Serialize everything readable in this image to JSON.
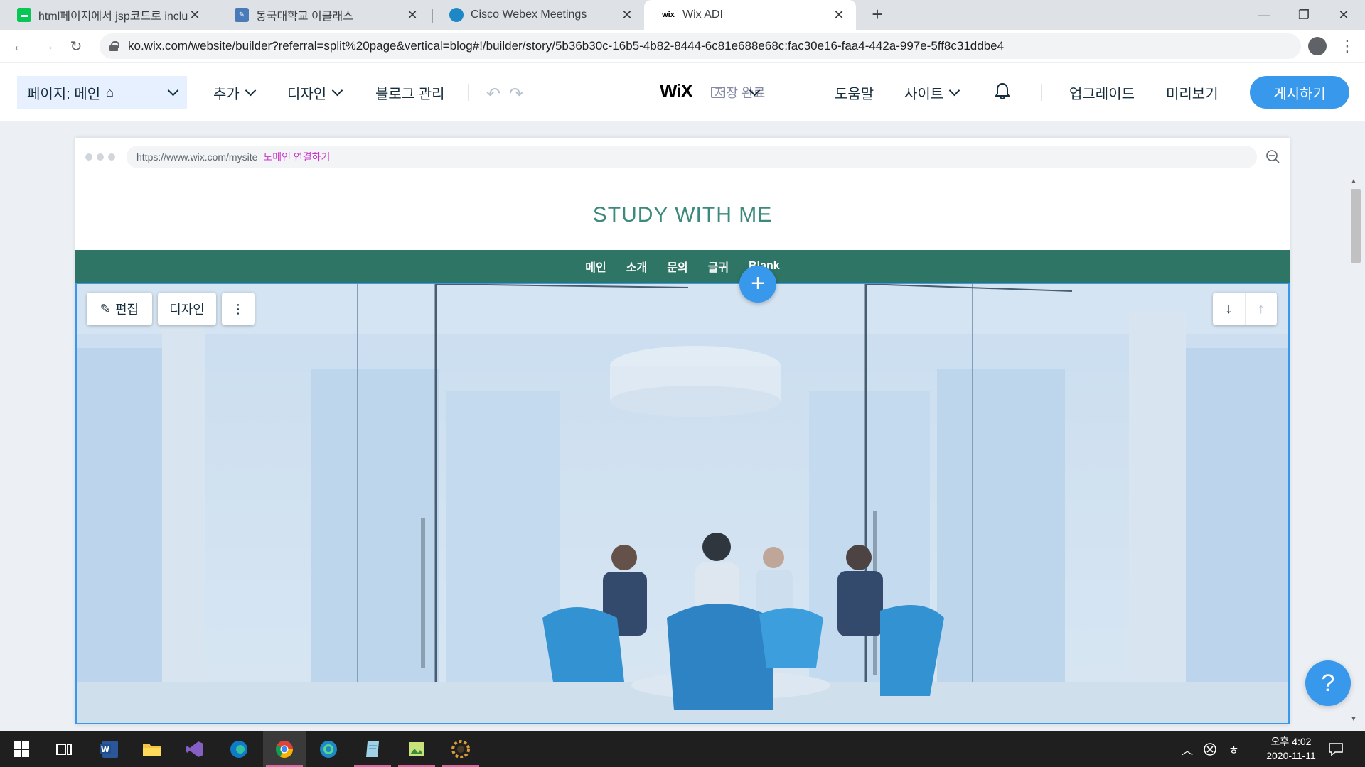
{
  "browser": {
    "tabs": [
      {
        "title": "html페이지에서 jsp코드로 incluc",
        "favicon": "line-icon",
        "color": "#06c755"
      },
      {
        "title": "동국대학교 이클래스",
        "favicon": "notepad-icon",
        "color": "#4a7ab8"
      },
      {
        "title": "Cisco Webex Meetings",
        "favicon": "webex-icon",
        "color": "#1e88c7"
      },
      {
        "title": "Wix ADI",
        "favicon": "wix-icon",
        "color": "#000000",
        "active": true
      }
    ],
    "url": "ko.wix.com/website/builder?referral=split%20page&vertical=blog#!/builder/story/5b36b30c-16b5-4b82-8444-6c81e688e68c:fac30e16-faa4-442a-997e-5ff8c31ddbe4"
  },
  "editor": {
    "page_selector": "페이지: 메인",
    "menu": {
      "add": "추가",
      "design": "디자인",
      "blog_manage": "블로그 관리"
    },
    "logo": "WiX",
    "saving": "저장 완료",
    "help": "도움말",
    "site": "사이트",
    "upgrade": "업그레이드",
    "preview": "미리보기",
    "publish": "게시하기",
    "accent_color": "#3899ec"
  },
  "canvas": {
    "site_url": "https://www.wix.com/mysite",
    "connect_domain": "도메인 연결하기",
    "site_title": "STUDY WITH ME",
    "nav": [
      "메인",
      "소개",
      "문의",
      "글귀",
      "Blank"
    ],
    "nav_color": "#2e7566",
    "edit_button": "편집",
    "design_button": "디자인",
    "add_symbol": "+",
    "more_symbol": "⋮"
  },
  "help_button": "?",
  "taskbar": {
    "apps": [
      "windows-start-icon",
      "task-view-icon",
      "word-icon",
      "file-explorer-icon",
      "visual-studio-icon",
      "edge-icon",
      "chrome-icon",
      "webex-icon",
      "notepad-icon",
      "image-viewer-icon",
      "settings-gear-icon"
    ],
    "time": "오후 4:02",
    "date": "2020-11-11"
  }
}
